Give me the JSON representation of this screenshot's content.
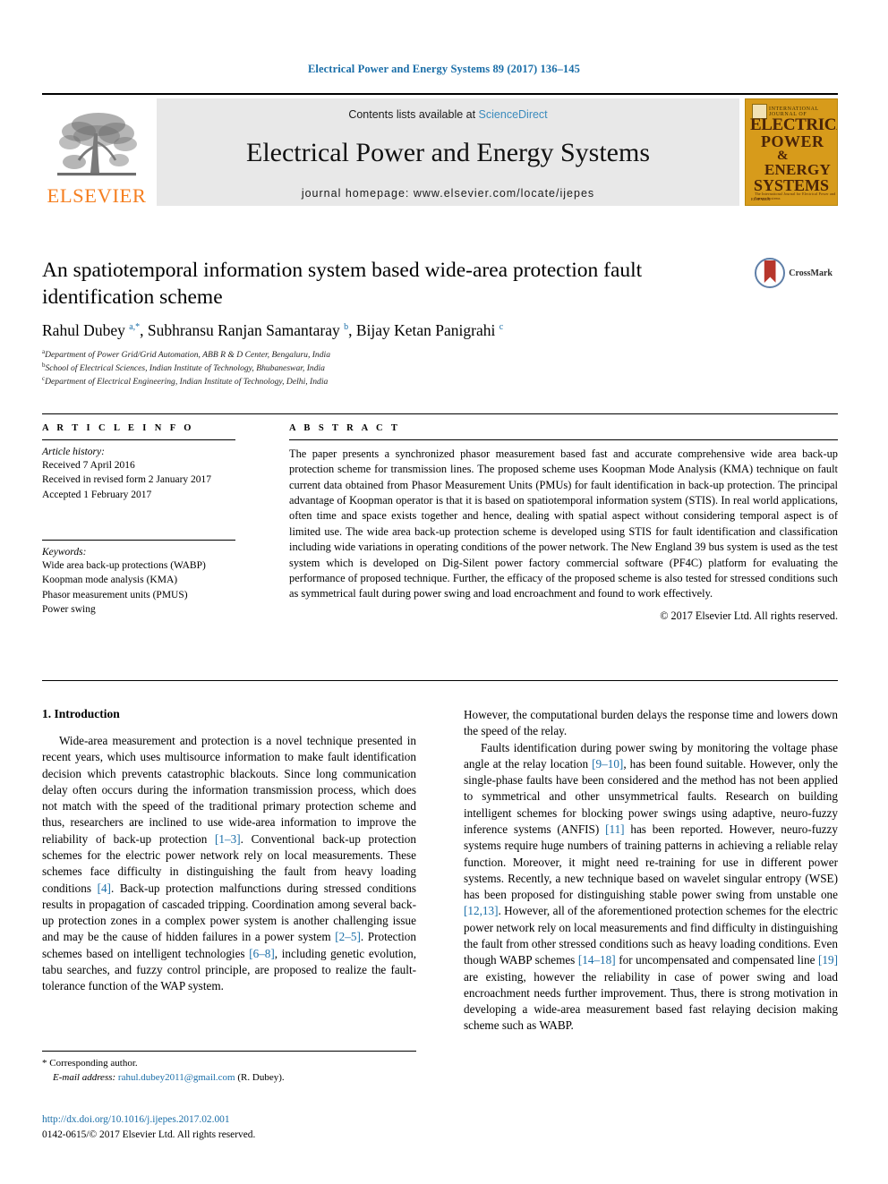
{
  "running_head": "Electrical Power and Energy Systems 89 (2017) 136–145",
  "masthead": {
    "contents_prefix": "Contents lists available at ",
    "sciencedirect": "ScienceDirect",
    "journal_title": "Electrical Power and Energy Systems",
    "homepage": "journal homepage: www.elsevier.com/locate/ijepes",
    "publisher_wordmark": "ELSEVIER",
    "publisher_color": "#F57F20",
    "cover": {
      "kicker": "INTERNATIONAL JOURNAL OF",
      "line1": "ELECTRICAL",
      "line2": "POWER",
      "line3": "&",
      "line4": "ENERGY",
      "line5": "SYSTEMS",
      "subtitle": "The International Journal for Electrical Power and Energy Systems",
      "background_color": "#D79B1B"
    }
  },
  "article": {
    "title": "An spatiotemporal information system based wide-area protection fault identification scheme",
    "crossmark_label": "CrossMark",
    "authors_html": "Rahul Dubey <sup class=\"star\">a,*</sup>, Subhransu Ranjan Samantaray <sup>b</sup>, Bijay Ketan Panigrahi <sup>c</sup>",
    "affiliations": [
      {
        "marker": "a",
        "text": "Department of Power Grid/Grid Automation, ABB R & D Center, Bengaluru, India"
      },
      {
        "marker": "b",
        "text": "School of Electrical Sciences, Indian Institute of Technology, Bhubaneswar, India"
      },
      {
        "marker": "c",
        "text": "Department of Electrical Engineering, Indian Institute of Technology, Delhi, India"
      }
    ]
  },
  "article_info": {
    "heading": "A R T I C L E  I N F O",
    "history_label": "Article history:",
    "history": [
      "Received 7 April 2016",
      "Received in revised form 2 January 2017",
      "Accepted 1 February 2017"
    ],
    "keywords_label": "Keywords:",
    "keywords": [
      "Wide area back-up protections (WABP)",
      "Koopman mode analysis (KMA)",
      "Phasor measurement units (PMUS)",
      "Power swing"
    ]
  },
  "abstract": {
    "heading": "A B S T R A C T",
    "body": "The paper presents a synchronized phasor measurement based fast and accurate comprehensive wide area back-up protection scheme for transmission lines. The proposed scheme uses Koopman Mode Analysis (KMA) technique on fault current data obtained from Phasor Measurement Units (PMUs) for fault identification in back-up protection. The principal advantage of Koopman operator is that it is based on spatiotemporal information system (STIS). In real world applications, often time and space exists together and hence, dealing with spatial aspect without considering temporal aspect is of limited use. The wide area back-up protection scheme is developed using STIS for fault identification and classification including wide variations in operating conditions of the power network. The New England 39 bus system is used as the test system which is developed on Dig-Silent power factory commercial software (PF4C) platform for evaluating the performance of proposed technique. Further, the efficacy of the proposed scheme is also tested for stressed conditions such as symmetrical fault during power swing and load encroachment and found to work effectively.",
    "copyright": "© 2017 Elsevier Ltd. All rights reserved."
  },
  "body": {
    "section_number_title": "1. Introduction",
    "left_paragraph_html": "Wide-area measurement and protection is a novel technique presented in recent years, which uses multisource information to make fault identification decision which prevents catastrophic blackouts. Since long communication delay often occurs during the information transmission process, which does not match with the speed of the traditional primary protection scheme and thus, researchers are inclined to use wide-area information to improve the reliability of back-up protection <span class=\"ref\">[1–3]</span>. Conventional back-up protection schemes for the electric power network rely on local measurements. These schemes face difficulty in distinguishing the fault from heavy loading conditions <span class=\"ref\">[4]</span>. Back-up protection malfunctions during stressed conditions results in propagation of cascaded tripping. Coordination among several back-up protection zones in a complex power system is another challenging issue and may be the cause of hidden failures in a power system <span class=\"ref\">[2–5]</span>. Protection schemes based on intelligent technologies <span class=\"ref\">[6–8]</span>, including genetic evolution, tabu searches, and fuzzy control principle, are proposed to realize the fault-tolerance function of the WAP system.",
    "right_paragraph_1_html": "However, the computational burden delays the response time and lowers down the speed of the relay.",
    "right_paragraph_2_html": "Faults identification during power swing by monitoring the voltage phase angle at the relay location <span class=\"ref\">[9–10]</span>, has been found suitable. However, only the single-phase faults have been considered and the method has not been applied to symmetrical and other unsymmetrical faults. Research on building intelligent schemes for blocking power swings using adaptive, neuro-fuzzy inference systems (ANFIS) <span class=\"ref\">[11]</span> has been reported. However, neuro-fuzzy systems require huge numbers of training patterns in achieving a reliable relay function. Moreover, it might need re-training for use in different power systems. Recently, a new technique based on wavelet singular entropy (WSE) has been proposed for distinguishing stable power swing from unstable one <span class=\"ref\">[12,13]</span>. However, all of the aforementioned protection schemes for the electric power network rely on local measurements and find difficulty in distinguishing the fault from other stressed conditions such as heavy loading conditions. Even though WABP schemes <span class=\"ref\">[14–18]</span> for uncompensated and compensated line <span class=\"ref\">[19]</span> are existing, however the reliability in case of power swing and load encroachment needs further improvement. Thus, there is strong motivation in developing a wide-area measurement based fast relaying decision making scheme such as WABP."
  },
  "footer": {
    "corresponding_marker": "*",
    "corresponding_label": "Corresponding author.",
    "email_label": "E-mail address:",
    "email": "rahul.dubey2011@gmail.com",
    "email_suffix": "(R. Dubey).",
    "doi": "http://dx.doi.org/10.1016/j.ijepes.2017.02.001",
    "issn_line": "0142-0615/© 2017 Elsevier Ltd. All rights reserved."
  },
  "colors": {
    "link_blue": "#1a6ea8",
    "elsevier_orange": "#F57F20",
    "band_gray": "#e8e8e8"
  }
}
